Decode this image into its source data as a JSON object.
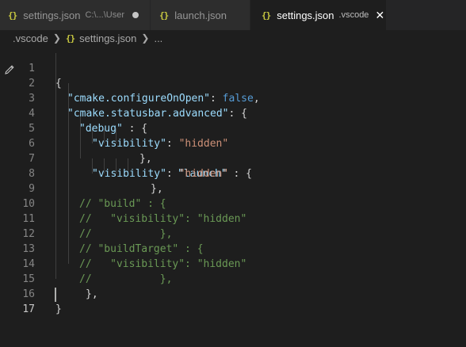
{
  "tabs": [
    {
      "label": "settings.json",
      "description": "C:\\...\\User",
      "icon": "json-braces-icon",
      "icon_text": "{}",
      "dirty": true,
      "active": false
    },
    {
      "label": "launch.json",
      "icon": "json-braces-icon",
      "icon_text": "{}",
      "active": false
    },
    {
      "label": "settings.json",
      "description": ".vscode",
      "icon": "json-braces-icon",
      "icon_text": "{}",
      "active": true,
      "close": "✕"
    }
  ],
  "breadcrumb": {
    "folder": ".vscode",
    "separator": "❯",
    "file_icon_text": "{}",
    "file": "settings.json",
    "ellipsis": "..."
  },
  "line_numbers": [
    "1",
    "2",
    "3",
    "4",
    "5",
    "6",
    "7",
    "8",
    "9",
    "10",
    "11",
    "12",
    "13",
    "14",
    "15",
    "16",
    "17"
  ],
  "code": {
    "l1": "{",
    "l2_key": "\"cmake.configureOnOpen\"",
    "l2_colon": ": ",
    "l2_val": "false",
    "l2_comma": ",",
    "l3_key": "\"cmake.statusbar.advanced\"",
    "l3_rest": ": {",
    "l4_key": "\"debug\"",
    "l4_rest": " : {",
    "l5_key": "\"visibility\"",
    "l5_colon": ": ",
    "l5_val": "\"hidden\"",
    "l6_close": "},",
    "l6_key": "\"launch\"",
    "l6_rest": " : {",
    "l7_key": "\"visibility\"",
    "l7_colon": ": ",
    "l7_val": "\"hidden\"",
    "l8": "},",
    "l9": "// \"build\" : {",
    "l10": "//   \"visibility\": \"hidden\"",
    "l11": "//           },",
    "l12": "// \"buildTarget\" : {",
    "l13": "//   \"visibility\": \"hidden\"",
    "l14": "//           },",
    "l15": "},",
    "l16": "}",
    "l17": ""
  },
  "colors": {
    "background": "#1e1e1e",
    "key": "#9cdcfe",
    "string": "#ce9178",
    "keyword": "#569cd6",
    "comment": "#6a9955",
    "json_icon": "#cbcb41"
  }
}
